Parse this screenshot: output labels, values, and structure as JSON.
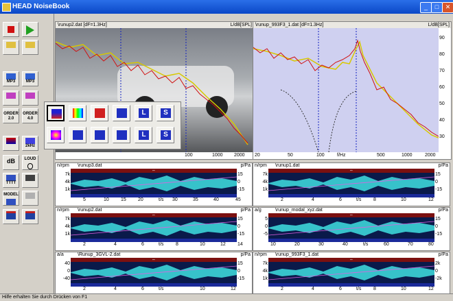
{
  "window": {
    "title": "HEAD NoiseBook"
  },
  "toolbar": {
    "buttons": [
      {
        "label": "",
        "icon": "stop-icon"
      },
      {
        "label": "",
        "icon": "play-icon"
      },
      {
        "label": "",
        "icon": "export-icon"
      },
      {
        "label": "",
        "icon": "import-icon"
      },
      {
        "label": "MP3",
        "icon": "mp3-export-icon"
      },
      {
        "label": "MP3",
        "icon": "mp3-import-icon"
      },
      {
        "label": "",
        "icon": "book-icon"
      },
      {
        "label": "",
        "icon": "book-chart-icon"
      },
      {
        "label": "ORDER 2.0",
        "icon": "order-icon"
      },
      {
        "label": "ORDER 4.0",
        "icon": "order-icon"
      },
      {
        "label": "",
        "icon": "spectrum-icon"
      },
      {
        "label": "2kHz",
        "icon": "filter-icon"
      },
      {
        "label": "dB",
        "icon": "db-icon"
      },
      {
        "label": "LOUD",
        "icon": "ear-icon"
      },
      {
        "label": "TTTT",
        "icon": "marker-icon"
      },
      {
        "label": "",
        "icon": "tape-icon"
      },
      {
        "label": "MODEL",
        "icon": "model-icon"
      },
      {
        "label": "",
        "icon": "photo-icon"
      },
      {
        "label": "",
        "icon": "flag-icon"
      },
      {
        "label": "",
        "icon": "flag-icon"
      }
    ]
  },
  "spectrum_left": {
    "file": "\\runup2.dat  [dF=1.3Hz]",
    "unit": "L/dB[SPL]",
    "yticks": [],
    "xticks": [
      "100",
      "1000",
      "2000"
    ]
  },
  "spectrum_right": {
    "file": "\\runup_993F3_1.dat  [dF=1.3Hz]",
    "unit": "L/dB[SPL]",
    "yticks": [
      "90",
      "80",
      "70",
      "60",
      "50",
      "40",
      "30"
    ],
    "xticks": [
      "20",
      "50",
      "100",
      "f/Hz",
      "500",
      "1000",
      "2000"
    ]
  },
  "analysis_buttons": [
    {
      "name": "spectrum-view-icon"
    },
    {
      "name": "colormap-view-icon"
    },
    {
      "name": "bar-view-icon"
    },
    {
      "name": "line-view-icon"
    },
    {
      "name": "loudness-l-icon"
    },
    {
      "name": "sharpness-s-icon"
    },
    {
      "name": "spectrogram-icon"
    },
    {
      "name": "roughness-icon"
    },
    {
      "name": "tonality-icon"
    },
    {
      "name": "fluctuation-icon"
    },
    {
      "name": "loudness-time-icon"
    },
    {
      "name": "sharpness-time-icon"
    }
  ],
  "time_panels": [
    {
      "left_unit": "n/rpm",
      "file": "\\runup3.dat",
      "right_unit": "p/Pa",
      "yl": [
        "7k",
        "4k",
        "1k"
      ],
      "yr": [
        "15",
        "0",
        "-15"
      ],
      "xticks": [
        "5",
        "10",
        "15",
        "20",
        "t/s",
        "30",
        "35",
        "40",
        "45"
      ]
    },
    {
      "left_unit": "n/rpm",
      "file": "\\runup1.dat",
      "right_unit": "p/Pa",
      "yl": [
        "7k",
        "4k",
        "1k"
      ],
      "yr": [
        "15",
        "0",
        "-15"
      ],
      "xticks": [
        "2",
        "4",
        "6",
        "t/s",
        "8",
        "10",
        "12"
      ]
    },
    {
      "left_unit": "n/rpm",
      "file": "\\runup2.dat",
      "right_unit": "p/Pa",
      "yl": [
        "7k",
        "4k",
        "1k"
      ],
      "yr": [
        "15",
        "0",
        "-15"
      ],
      "xticks": [
        "2",
        "4",
        "6",
        "t/s",
        "8",
        "10",
        "12",
        "14"
      ]
    },
    {
      "left_unit": "a/g",
      "file": "\\runup_modal_xyz.dat",
      "right_unit": "p/Pa",
      "yl": [
        "5",
        "0",
        "-5"
      ],
      "yr": [
        "15",
        "0",
        "-15"
      ],
      "xticks": [
        "10",
        "20",
        "30",
        "40",
        "t/s",
        "60",
        "70",
        "80"
      ]
    },
    {
      "left_unit": "a/a",
      "file": "\\Runup_3GVL-2.dat",
      "right_unit": "p/Pa",
      "yl": [
        "40",
        "0",
        "-40"
      ],
      "yr": [
        "15",
        "0",
        "-15"
      ],
      "xticks": [
        "2",
        "4",
        "6",
        "t/s",
        "10",
        "12"
      ]
    },
    {
      "left_unit": "n/rpm",
      "file": "\\runup_993F3_1.dat",
      "right_unit": "p/Pa",
      "yl": [
        "7k",
        "4k",
        "1k"
      ],
      "yr": [
        "2k",
        "0",
        "-2k"
      ],
      "xticks": [
        "2",
        "4",
        "6",
        "t/s",
        "8",
        "10",
        "12"
      ]
    }
  ],
  "status": {
    "text": "Hilfe erhalten Sie durch Drücken von F1"
  }
}
